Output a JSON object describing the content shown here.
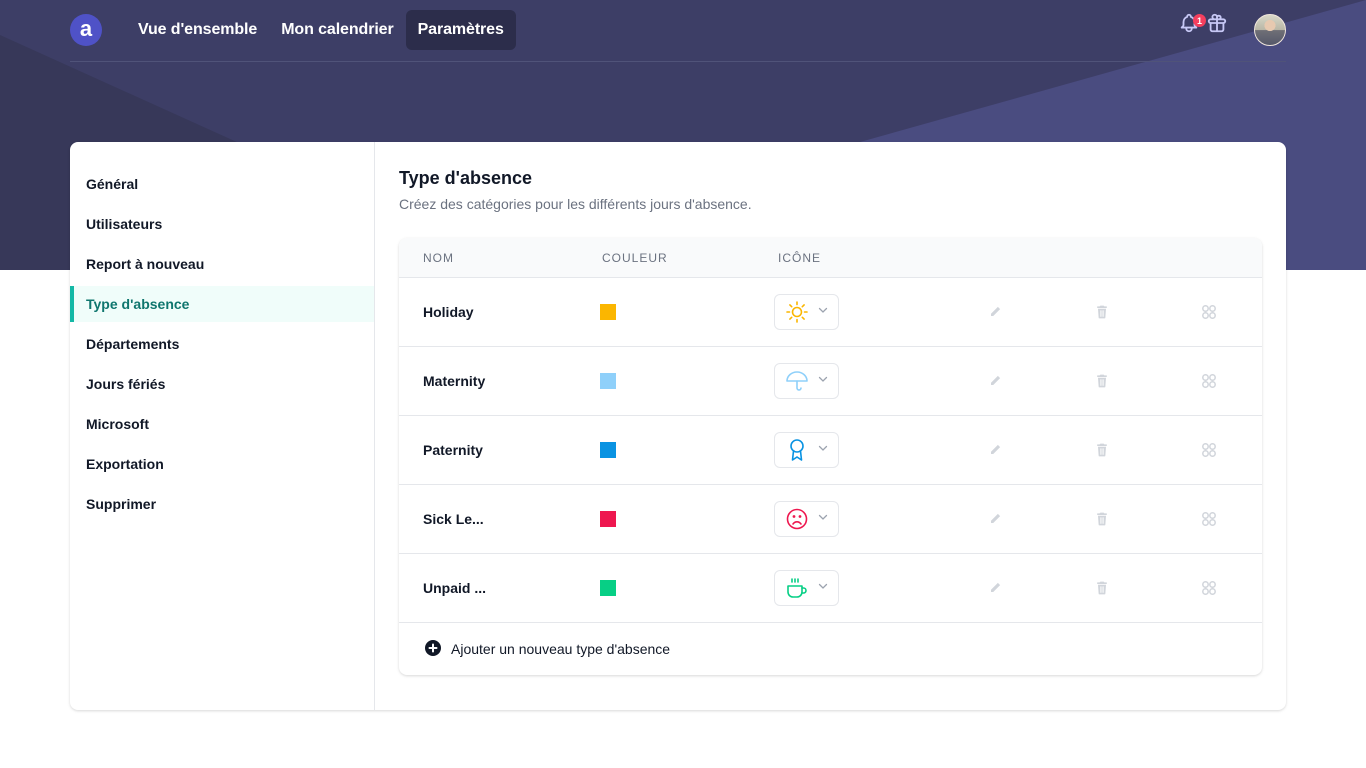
{
  "app": {
    "logo_letter": "a",
    "nav": [
      {
        "label": "Vue d'ensemble",
        "active": false
      },
      {
        "label": "Mon calendrier",
        "active": false
      },
      {
        "label": "Paramètres",
        "active": true
      }
    ],
    "notifications_count": "1",
    "icons": {
      "notifications": "bell-icon",
      "gifts": "gift-icon",
      "avatar": "user-avatar"
    }
  },
  "sidebar": {
    "items": [
      {
        "label": "Général",
        "active": false
      },
      {
        "label": "Utilisateurs",
        "active": false
      },
      {
        "label": "Report à nouveau",
        "active": false
      },
      {
        "label": "Type d'absence",
        "active": true
      },
      {
        "label": "Départements",
        "active": false
      },
      {
        "label": "Jours fériés",
        "active": false
      },
      {
        "label": "Microsoft",
        "active": false
      },
      {
        "label": "Exportation",
        "active": false
      },
      {
        "label": "Supprimer",
        "active": false
      }
    ]
  },
  "main": {
    "title": "Type d'absence",
    "subtitle": "Créez des catégories pour les différents jours d'absence.",
    "table": {
      "columns": [
        "NOM",
        "COULEUR",
        "ICÔNE"
      ],
      "rows": [
        {
          "name": "Holiday",
          "color": "#fbb600",
          "icon": "sun-icon"
        },
        {
          "name": "Maternity",
          "color": "#8fd0fa",
          "icon": "umbrella-icon"
        },
        {
          "name": "Paternity",
          "color": "#0a93e2",
          "icon": "ribbon-award-icon"
        },
        {
          "name": "Sick Le...",
          "color": "#ee174f",
          "icon": "sad-face-icon"
        },
        {
          "name": "Unpaid ...",
          "color": "#07cf85",
          "icon": "coffee-cup-icon"
        }
      ],
      "row_actions": [
        "edit",
        "delete",
        "reorder"
      ]
    },
    "add_label": "Ajouter un nouveau type d'absence"
  },
  "colors": {
    "header_bg": "#3d3e66",
    "header_accent": "#4a4c80",
    "active_accent": "#14b8a6",
    "badge": "#f43f5e"
  }
}
